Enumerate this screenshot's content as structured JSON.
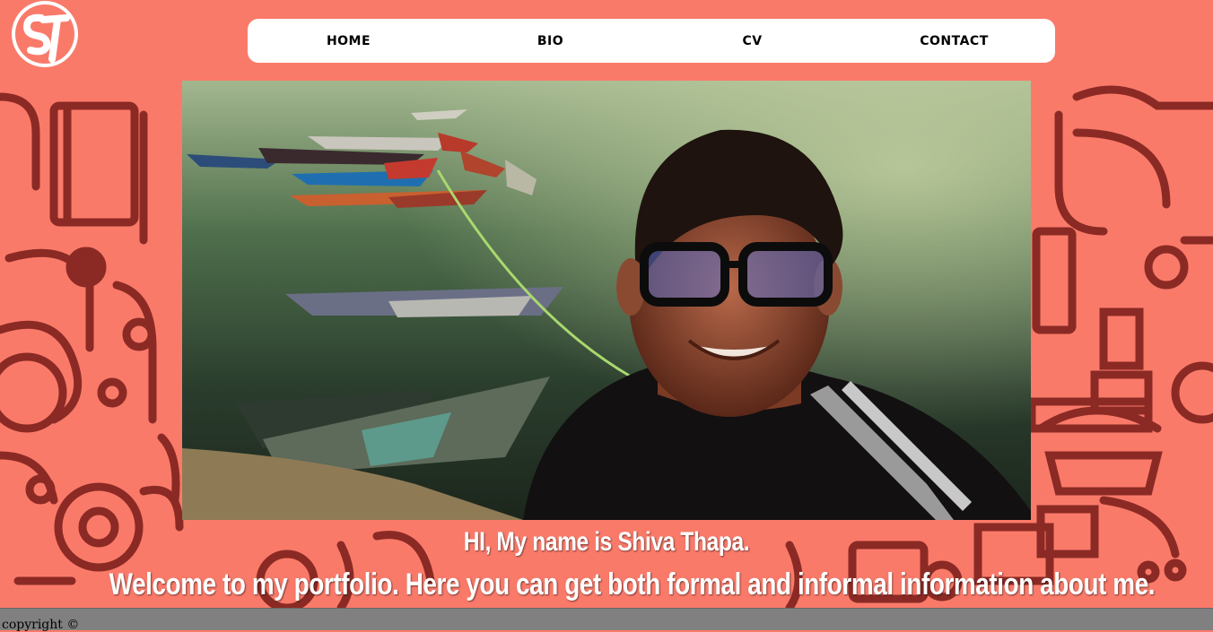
{
  "logo": {
    "icon": "st-monogram-logo",
    "letters": "ST"
  },
  "nav": {
    "items": [
      {
        "label": "HOME"
      },
      {
        "label": "BIO"
      },
      {
        "label": "CV"
      },
      {
        "label": "CONTACT"
      }
    ]
  },
  "hero": {
    "image_description_icon": "profile-photo"
  },
  "intro": {
    "line1": "HI, My name is Shiva Thapa.",
    "line2": "Welcome to my portfolio. Here you can get both formal and informal information about me."
  },
  "footer": {
    "copyright": "copyright ©"
  },
  "colors": {
    "background": "#fa7a6a",
    "pattern": "#8b2a24",
    "nav_bg": "#ffffff",
    "footer_bg": "#808080"
  }
}
